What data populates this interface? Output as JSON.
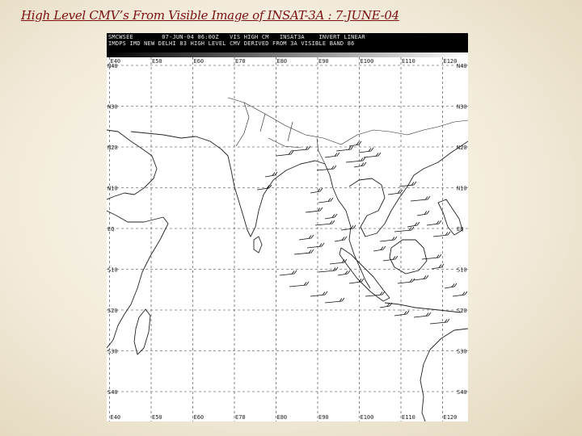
{
  "slide": {
    "title": "High Level  CMV’s  From  Visible Image of INSAT-3A : 7-JUNE-04"
  },
  "image": {
    "header_line1": "SMCWSEE        07-JUN-04 06:00Z   VIS HIGH CM   INSAT3A    INVERT LINEAR",
    "header_line2": "IMDPS IMD NEW DELHI 83 HIGH LEVEL CMV DERIVED FROM 3A VISIBLE BAND 86",
    "lon_labels": [
      "E40",
      "E50",
      "E60",
      "E70",
      "E80",
      "E90",
      "E100",
      "E110",
      "E120"
    ],
    "lat_labels_left": [
      "N40",
      "N30",
      "N20",
      "N10",
      "EQ",
      "S10",
      "S20",
      "S30",
      "S40"
    ],
    "lat_labels_right": [
      "N40",
      "N30",
      "N20",
      "N10",
      "EQ",
      "S10",
      "S20",
      "S30",
      "S40"
    ]
  }
}
